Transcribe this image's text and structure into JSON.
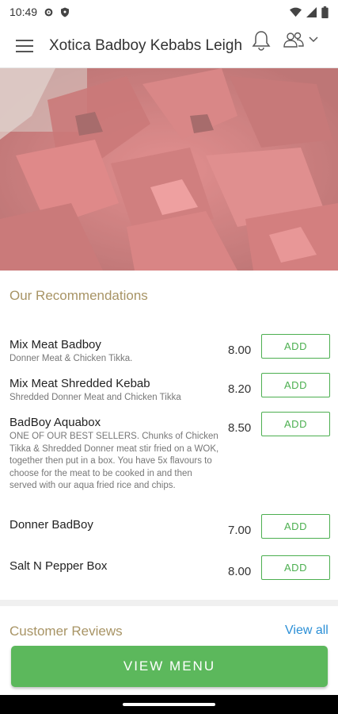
{
  "status_bar": {
    "time": "10:49",
    "icons": [
      "settings-icon",
      "shield-icon",
      "wifi-icon",
      "signal-icon",
      "battery-icon"
    ]
  },
  "app_bar": {
    "title": "Xotica Badboy Kebabs Leigh",
    "icons": [
      "menu-icon",
      "bell-icon",
      "users-icon",
      "chevron-down-icon"
    ]
  },
  "hero": {
    "description": "food-photo"
  },
  "recommendations": {
    "title": "Our Recommendations",
    "add_label": "ADD",
    "items": [
      {
        "name": "Mix Meat Badboy",
        "description": "Donner Meat & Chicken Tikka.",
        "price": "8.00"
      },
      {
        "name": "Mix Meat Shredded Kebab",
        "description": "Shredded Donner Meat and Chicken Tikka",
        "price": "8.20"
      },
      {
        "name": "BadBoy Aquabox",
        "description": "ONE OF OUR BEST SELLERS. Chunks of Chicken Tikka & Shredded Donner meat stir fried on a WOK, together then put in a box. You have 5x flavours to choose for the meat to be cooked in and then served with our aqua fried rice and chips.",
        "price": "8.50"
      },
      {
        "name": "Donner BadBoy",
        "description": "",
        "price": "7.00"
      },
      {
        "name": "Salt N Pepper Box",
        "description": "",
        "price": "8.00"
      }
    ]
  },
  "reviews": {
    "title": "Customer Reviews",
    "view_all": "View all"
  },
  "footer": {
    "view_menu": "VIEW MENU"
  },
  "colors": {
    "accent_green": "#5cb85c",
    "section_gold": "#a89465",
    "link_blue": "#2b8fd6"
  }
}
